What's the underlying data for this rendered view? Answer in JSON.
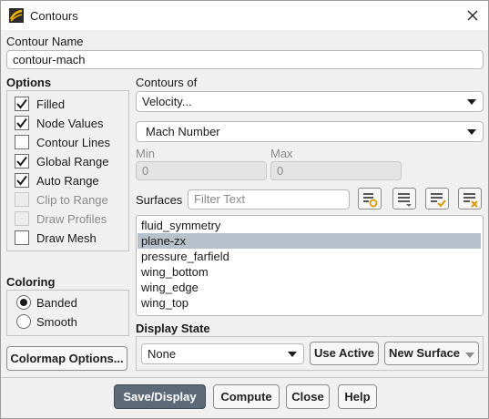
{
  "window": {
    "title": "Contours",
    "icon": "ansys-fluent-icon",
    "close_icon": "close-icon"
  },
  "contour_name": {
    "label": "Contour Name",
    "value": "contour-mach"
  },
  "options": {
    "heading": "Options",
    "items": [
      {
        "label": "Filled",
        "checked": true,
        "enabled": true
      },
      {
        "label": "Node Values",
        "checked": true,
        "enabled": true
      },
      {
        "label": "Contour Lines",
        "checked": false,
        "enabled": true
      },
      {
        "label": "Global Range",
        "checked": true,
        "enabled": true
      },
      {
        "label": "Auto Range",
        "checked": true,
        "enabled": true
      },
      {
        "label": "Clip to Range",
        "checked": false,
        "enabled": false
      },
      {
        "label": "Draw Profiles",
        "checked": false,
        "enabled": false
      },
      {
        "label": "Draw Mesh",
        "checked": false,
        "enabled": true
      }
    ]
  },
  "contours_of": {
    "label": "Contours of",
    "category": "Velocity...",
    "quantity": "Mach Number"
  },
  "range": {
    "min_label": "Min",
    "min_value": "0",
    "max_label": "Max",
    "max_value": "0"
  },
  "surfaces": {
    "label": "Surfaces",
    "filter_placeholder": "Filter Text",
    "toolbar_icons": [
      "new-surface-icon",
      "select-all-icon",
      "select-all-check-icon",
      "deselect-all-icon"
    ],
    "items": [
      "fluid_symmetry",
      "plane-zx",
      "pressure_farfield",
      "wing_bottom",
      "wing_edge",
      "wing_top"
    ],
    "selected": "plane-zx"
  },
  "coloring": {
    "heading": "Coloring",
    "options": [
      {
        "label": "Banded",
        "selected": true
      },
      {
        "label": "Smooth",
        "selected": false
      }
    ]
  },
  "colormap_button": "Colormap Options...",
  "display_state": {
    "heading": "Display State",
    "value": "None",
    "use_active": "Use Active",
    "new_surface": "New Surface"
  },
  "footer": {
    "save_display": "Save/Display",
    "compute": "Compute",
    "close": "Close",
    "help": "Help"
  }
}
